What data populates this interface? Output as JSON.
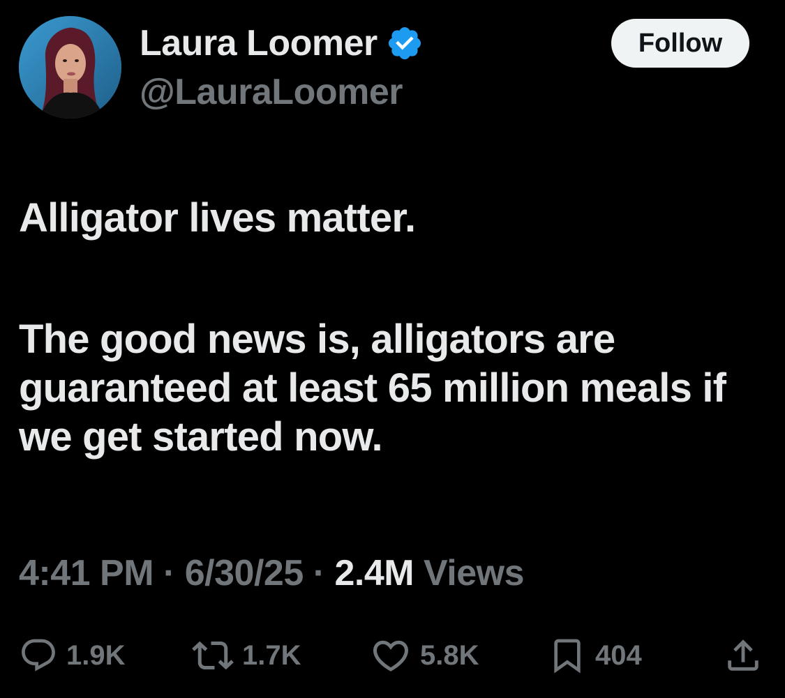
{
  "author": {
    "display_name": "Laura Loomer",
    "handle": "@LauraLoomer",
    "verified": true,
    "verified_color": "#1d9bf0"
  },
  "follow_button": {
    "label": "Follow"
  },
  "tweet": {
    "paragraphs": [
      "Alligator lives matter.",
      "The good news is, alligators are guaranteed at least 65 million meals if we get started now."
    ]
  },
  "meta": {
    "time": "4:41 PM",
    "date": "6/30/25",
    "separator": "·",
    "views_count": "2.4M",
    "views_label": "Views"
  },
  "actions": {
    "reply": {
      "icon": "reply-icon",
      "count": "1.9K"
    },
    "repost": {
      "icon": "repost-icon",
      "count": "1.7K"
    },
    "like": {
      "icon": "heart-icon",
      "count": "5.8K"
    },
    "bookmark": {
      "icon": "bookmark-icon",
      "count": "404"
    },
    "share": {
      "icon": "share-icon"
    }
  },
  "colors": {
    "background": "#000000",
    "text_primary": "#e7e9ea",
    "text_secondary": "#71767b",
    "follow_bg": "#eff3f4"
  }
}
